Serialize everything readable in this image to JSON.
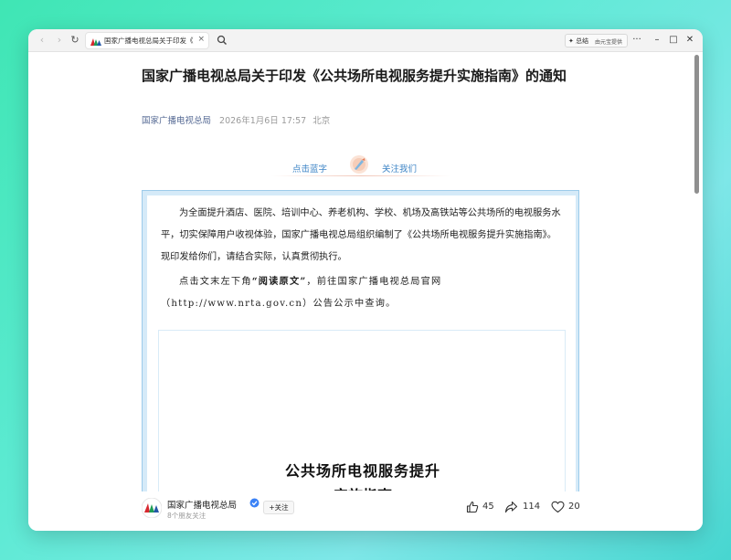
{
  "browser": {
    "tab_title": "国家广播电视总局关于印发《",
    "tab_close": "×",
    "nav_back": "‹",
    "nav_forward": "›",
    "nav_reload": "↻",
    "summary_label": "总结",
    "summary_sub": "由元宝提供",
    "more": "···",
    "minimize": "–",
    "maximize": "□",
    "close": "✕"
  },
  "article": {
    "title": "国家广播电视总局关于印发《公共场所电视服务提升实施指南》的通知",
    "author": "国家广播电视总局",
    "date": "2026年1月6日 17:57",
    "location": "北京"
  },
  "banner": {
    "left": "点击蓝字",
    "right": "关注我们"
  },
  "content": {
    "para1": "为全面提升酒店、医院、培训中心、养老机构、学校、机场及高铁站等公共场所的电视服务水平，切实保障用户收视体验，国家广播电视总局组织编制了《公共场所电视服务提升实施指南》。现印发给你们，请结合实际，认真贯彻执行。",
    "para2_pre": "点击文末左下角",
    "para2_bold": "“阅读原文”",
    "para2_post": "，前往国家广播电视总局官网（http://www.nrta.gov.cn）公告公示中查询。",
    "doc_heading": "公共场所电视服务提升",
    "doc_heading2": "实施指南"
  },
  "bottom": {
    "name": "国家广播电视总局",
    "follow": "+关注",
    "friends": "8个朋友关注",
    "likes": "45",
    "shares": "114",
    "favorites": "20"
  },
  "colors": {
    "link": "#576b95",
    "banner_text": "#3d84c6",
    "frame": "#9ccbea"
  }
}
